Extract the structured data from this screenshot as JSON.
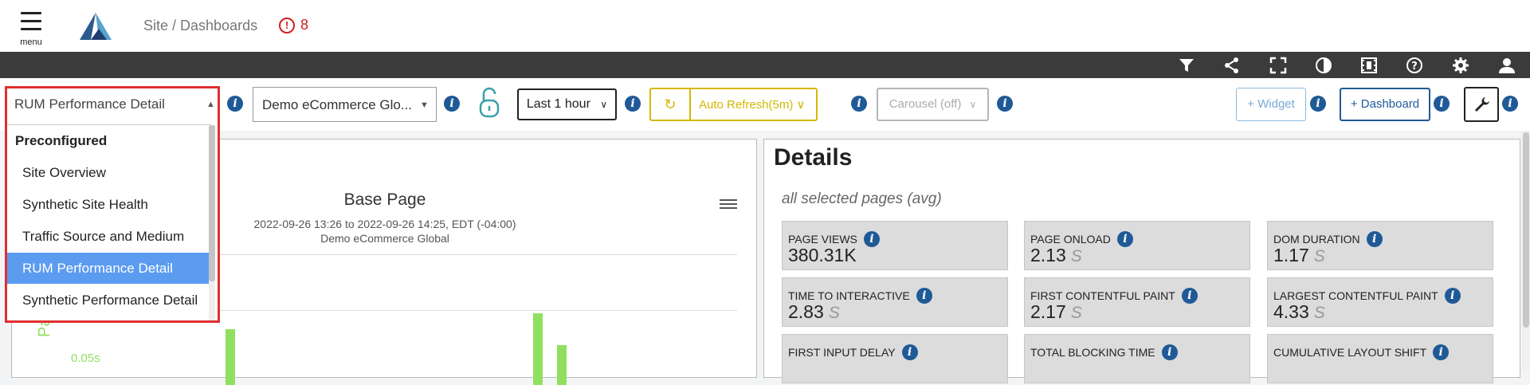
{
  "header": {
    "menu_label": "menu",
    "breadcrumb": "Site / Dashboards",
    "alert_count": "8"
  },
  "toolbar": {
    "icons": [
      "filter-icon",
      "share-icon",
      "fullscreen-icon",
      "contrast-icon",
      "film-icon",
      "help-icon",
      "gear-icon",
      "user-icon"
    ]
  },
  "controls": {
    "dashboard_select": "RUM Performance Detail",
    "site_select": "Demo eCommerce Glo...",
    "time_range": "Last 1 hour",
    "auto_refresh": "Auto Refresh(5m)",
    "carousel": "Carousel (off)",
    "add_widget": "+ Widget",
    "add_dashboard": "+ Dashboard"
  },
  "dropdown": {
    "group_label": "Preconfigured",
    "items": [
      "Site Overview",
      "Synthetic Site Health",
      "Traffic Source and Medium",
      "RUM Performance Detail",
      "Synthetic Performance Detail"
    ],
    "selected": "RUM Performance Detail"
  },
  "chart": {
    "title": "Base Page",
    "date_range": "2022-09-26 13:26 to 2022-09-26 14:25, EDT (-04:00)",
    "site": "Demo eCommerce Global",
    "y_axis_fragment": "Pag",
    "y_tick": "0.05s"
  },
  "details": {
    "title": "Details",
    "subtitle": "all selected pages (avg)",
    "metrics": [
      {
        "label": "PAGE VIEWS",
        "value": "380.31K",
        "unit": ""
      },
      {
        "label": "PAGE ONLOAD",
        "value": "2.13",
        "unit": "S"
      },
      {
        "label": "DOM DURATION",
        "value": "1.17",
        "unit": "S"
      },
      {
        "label": "TIME TO INTERACTIVE",
        "value": "2.83",
        "unit": "S"
      },
      {
        "label": "FIRST CONTENTFUL PAINT",
        "value": "2.17",
        "unit": "S"
      },
      {
        "label": "LARGEST CONTENTFUL PAINT",
        "value": "4.33",
        "unit": "S"
      },
      {
        "label": "FIRST INPUT DELAY",
        "value": "",
        "unit": ""
      },
      {
        "label": "TOTAL BLOCKING TIME",
        "value": "",
        "unit": ""
      },
      {
        "label": "CUMULATIVE LAYOUT SHIFT",
        "value": "",
        "unit": ""
      }
    ]
  },
  "colors": {
    "accent_blue": "#1f5a96",
    "alert_red": "#d02020",
    "refresh_yellow": "#d4b800",
    "bar_green": "#90e060",
    "dropdown_border": "#e03030",
    "selected_item": "#5b9bf0"
  }
}
